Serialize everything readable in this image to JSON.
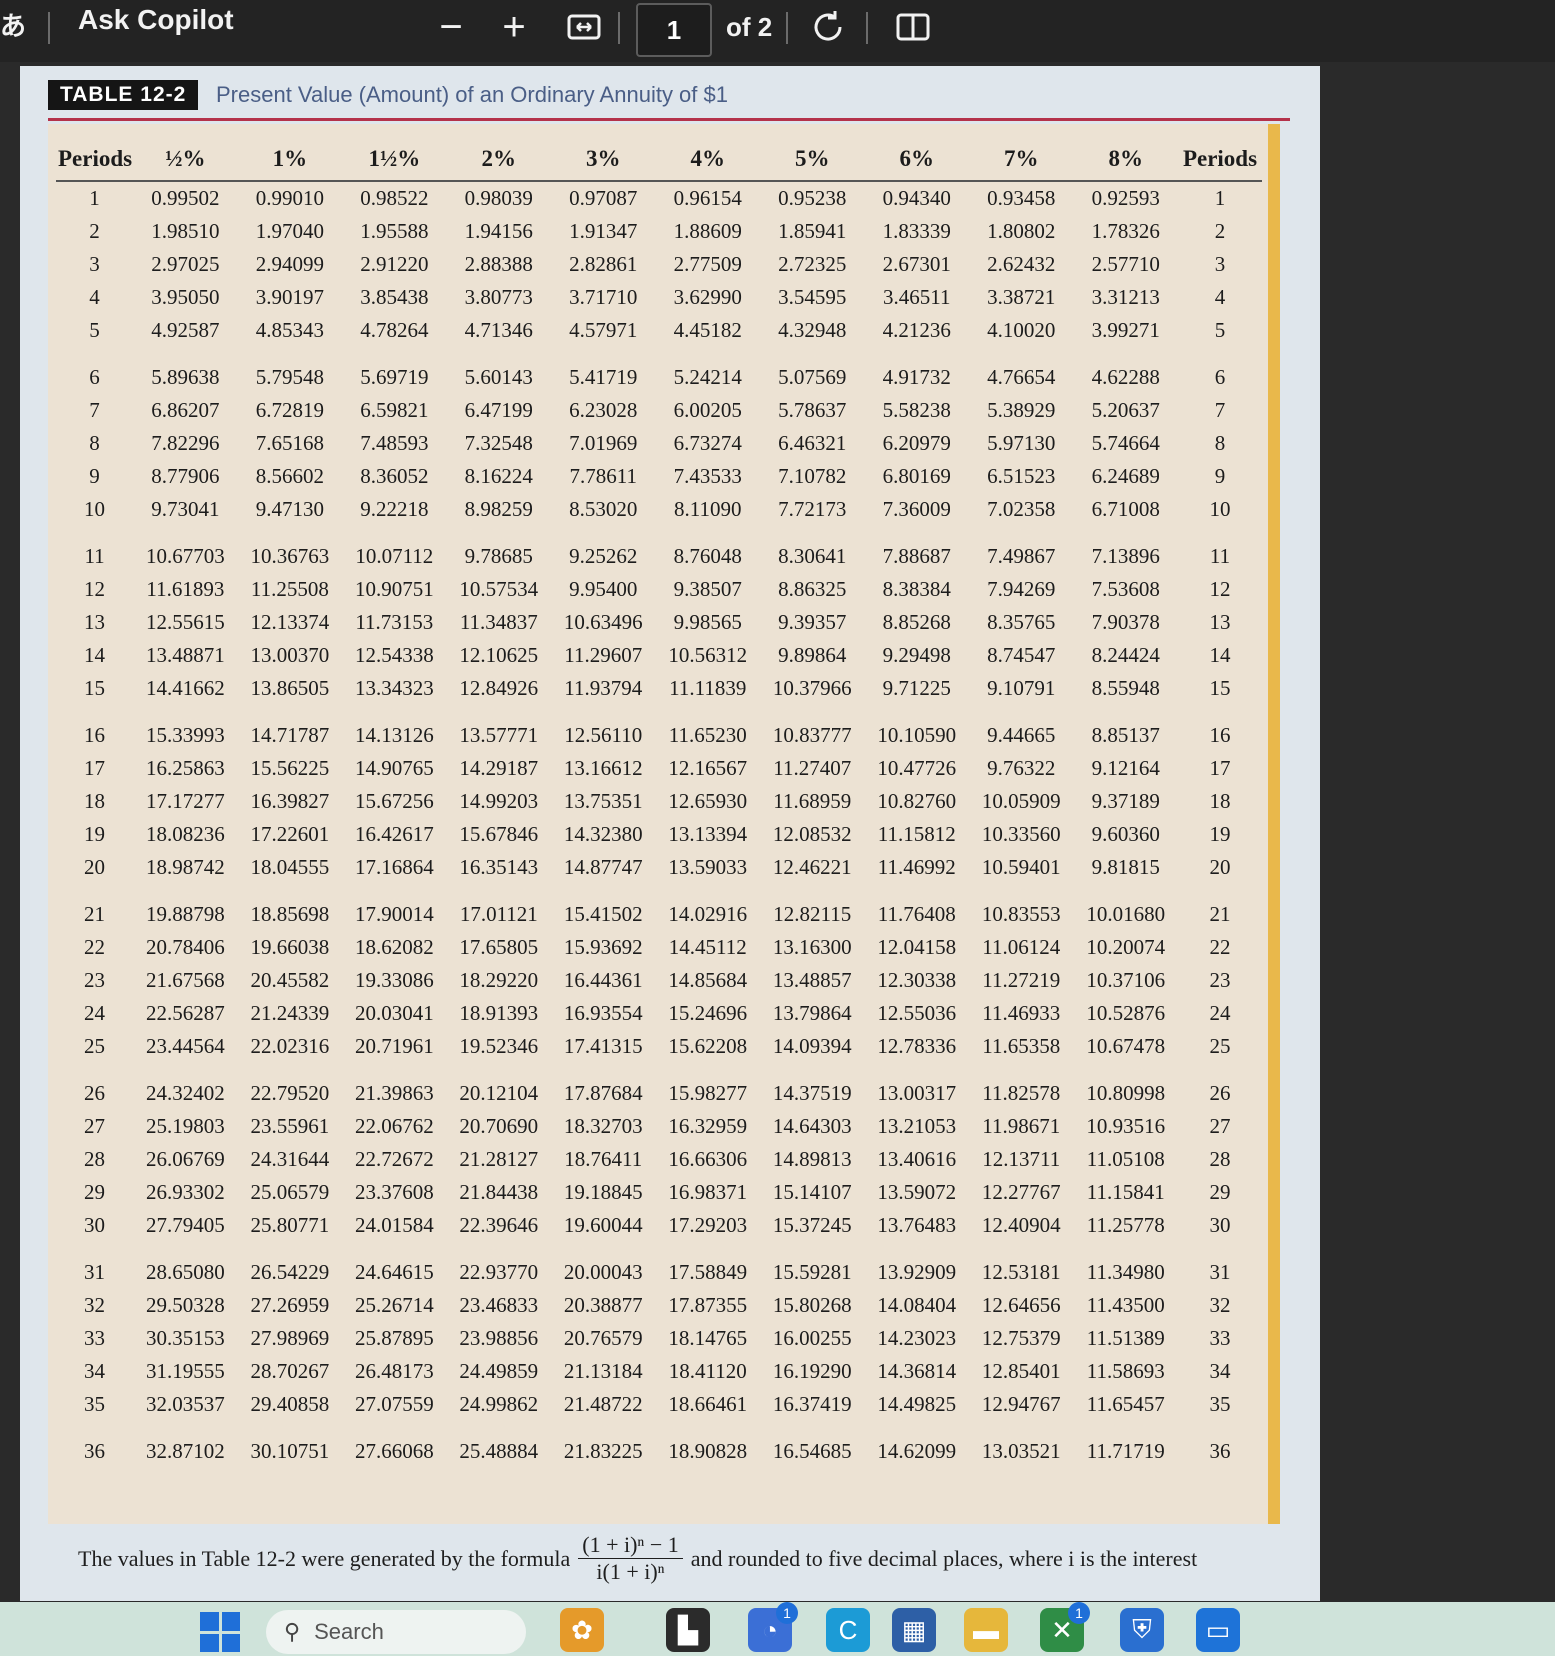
{
  "toolbar": {
    "lang_icon": "あ",
    "title": "Ask Copilot",
    "zoom_out": "−",
    "zoom_in": "+",
    "fit_icon": "fit-page-icon",
    "page_number": "1",
    "page_total": "of 2",
    "rotate_icon": "rotate-icon",
    "view_icon": "page-view-icon"
  },
  "document": {
    "table_label": "TABLE 12-2",
    "table_title": "Present Value (Amount) of an Ordinary Annuity of $1",
    "columns": [
      "Periods",
      "½%",
      "1%",
      "1½%",
      "2%",
      "3%",
      "4%",
      "5%",
      "6%",
      "7%",
      "8%",
      "Periods"
    ],
    "rows": [
      [
        "1",
        "0.99502",
        "0.99010",
        "0.98522",
        "0.98039",
        "0.97087",
        "0.96154",
        "0.95238",
        "0.94340",
        "0.93458",
        "0.92593",
        "1"
      ],
      [
        "2",
        "1.98510",
        "1.97040",
        "1.95588",
        "1.94156",
        "1.91347",
        "1.88609",
        "1.85941",
        "1.83339",
        "1.80802",
        "1.78326",
        "2"
      ],
      [
        "3",
        "2.97025",
        "2.94099",
        "2.91220",
        "2.88388",
        "2.82861",
        "2.77509",
        "2.72325",
        "2.67301",
        "2.62432",
        "2.57710",
        "3"
      ],
      [
        "4",
        "3.95050",
        "3.90197",
        "3.85438",
        "3.80773",
        "3.71710",
        "3.62990",
        "3.54595",
        "3.46511",
        "3.38721",
        "3.31213",
        "4"
      ],
      [
        "5",
        "4.92587",
        "4.85343",
        "4.78264",
        "4.71346",
        "4.57971",
        "4.45182",
        "4.32948",
        "4.21236",
        "4.10020",
        "3.99271",
        "5"
      ],
      [
        "6",
        "5.89638",
        "5.79548",
        "5.69719",
        "5.60143",
        "5.41719",
        "5.24214",
        "5.07569",
        "4.91732",
        "4.76654",
        "4.62288",
        "6"
      ],
      [
        "7",
        "6.86207",
        "6.72819",
        "6.59821",
        "6.47199",
        "6.23028",
        "6.00205",
        "5.78637",
        "5.58238",
        "5.38929",
        "5.20637",
        "7"
      ],
      [
        "8",
        "7.82296",
        "7.65168",
        "7.48593",
        "7.32548",
        "7.01969",
        "6.73274",
        "6.46321",
        "6.20979",
        "5.97130",
        "5.74664",
        "8"
      ],
      [
        "9",
        "8.77906",
        "8.56602",
        "8.36052",
        "8.16224",
        "7.78611",
        "7.43533",
        "7.10782",
        "6.80169",
        "6.51523",
        "6.24689",
        "9"
      ],
      [
        "10",
        "9.73041",
        "9.47130",
        "9.22218",
        "8.98259",
        "8.53020",
        "8.11090",
        "7.72173",
        "7.36009",
        "7.02358",
        "6.71008",
        "10"
      ],
      [
        "11",
        "10.67703",
        "10.36763",
        "10.07112",
        "9.78685",
        "9.25262",
        "8.76048",
        "8.30641",
        "7.88687",
        "7.49867",
        "7.13896",
        "11"
      ],
      [
        "12",
        "11.61893",
        "11.25508",
        "10.90751",
        "10.57534",
        "9.95400",
        "9.38507",
        "8.86325",
        "8.38384",
        "7.94269",
        "7.53608",
        "12"
      ],
      [
        "13",
        "12.55615",
        "12.13374",
        "11.73153",
        "11.34837",
        "10.63496",
        "9.98565",
        "9.39357",
        "8.85268",
        "8.35765",
        "7.90378",
        "13"
      ],
      [
        "14",
        "13.48871",
        "13.00370",
        "12.54338",
        "12.10625",
        "11.29607",
        "10.56312",
        "9.89864",
        "9.29498",
        "8.74547",
        "8.24424",
        "14"
      ],
      [
        "15",
        "14.41662",
        "13.86505",
        "13.34323",
        "12.84926",
        "11.93794",
        "11.11839",
        "10.37966",
        "9.71225",
        "9.10791",
        "8.55948",
        "15"
      ],
      [
        "16",
        "15.33993",
        "14.71787",
        "14.13126",
        "13.57771",
        "12.56110",
        "11.65230",
        "10.83777",
        "10.10590",
        "9.44665",
        "8.85137",
        "16"
      ],
      [
        "17",
        "16.25863",
        "15.56225",
        "14.90765",
        "14.29187",
        "13.16612",
        "12.16567",
        "11.27407",
        "10.47726",
        "9.76322",
        "9.12164",
        "17"
      ],
      [
        "18",
        "17.17277",
        "16.39827",
        "15.67256",
        "14.99203",
        "13.75351",
        "12.65930",
        "11.68959",
        "10.82760",
        "10.05909",
        "9.37189",
        "18"
      ],
      [
        "19",
        "18.08236",
        "17.22601",
        "16.42617",
        "15.67846",
        "14.32380",
        "13.13394",
        "12.08532",
        "11.15812",
        "10.33560",
        "9.60360",
        "19"
      ],
      [
        "20",
        "18.98742",
        "18.04555",
        "17.16864",
        "16.35143",
        "14.87747",
        "13.59033",
        "12.46221",
        "11.46992",
        "10.59401",
        "9.81815",
        "20"
      ],
      [
        "21",
        "19.88798",
        "18.85698",
        "17.90014",
        "17.01121",
        "15.41502",
        "14.02916",
        "12.82115",
        "11.76408",
        "10.83553",
        "10.01680",
        "21"
      ],
      [
        "22",
        "20.78406",
        "19.66038",
        "18.62082",
        "17.65805",
        "15.93692",
        "14.45112",
        "13.16300",
        "12.04158",
        "11.06124",
        "10.20074",
        "22"
      ],
      [
        "23",
        "21.67568",
        "20.45582",
        "19.33086",
        "18.29220",
        "16.44361",
        "14.85684",
        "13.48857",
        "12.30338",
        "11.27219",
        "10.37106",
        "23"
      ],
      [
        "24",
        "22.56287",
        "21.24339",
        "20.03041",
        "18.91393",
        "16.93554",
        "15.24696",
        "13.79864",
        "12.55036",
        "11.46933",
        "10.52876",
        "24"
      ],
      [
        "25",
        "23.44564",
        "22.02316",
        "20.71961",
        "19.52346",
        "17.41315",
        "15.62208",
        "14.09394",
        "12.78336",
        "11.65358",
        "10.67478",
        "25"
      ],
      [
        "26",
        "24.32402",
        "22.79520",
        "21.39863",
        "20.12104",
        "17.87684",
        "15.98277",
        "14.37519",
        "13.00317",
        "11.82578",
        "10.80998",
        "26"
      ],
      [
        "27",
        "25.19803",
        "23.55961",
        "22.06762",
        "20.70690",
        "18.32703",
        "16.32959",
        "14.64303",
        "13.21053",
        "11.98671",
        "10.93516",
        "27"
      ],
      [
        "28",
        "26.06769",
        "24.31644",
        "22.72672",
        "21.28127",
        "18.76411",
        "16.66306",
        "14.89813",
        "13.40616",
        "12.13711",
        "11.05108",
        "28"
      ],
      [
        "29",
        "26.93302",
        "25.06579",
        "23.37608",
        "21.84438",
        "19.18845",
        "16.98371",
        "15.14107",
        "13.59072",
        "12.27767",
        "11.15841",
        "29"
      ],
      [
        "30",
        "27.79405",
        "25.80771",
        "24.01584",
        "22.39646",
        "19.60044",
        "17.29203",
        "15.37245",
        "13.76483",
        "12.40904",
        "11.25778",
        "30"
      ],
      [
        "31",
        "28.65080",
        "26.54229",
        "24.64615",
        "22.93770",
        "20.00043",
        "17.58849",
        "15.59281",
        "13.92909",
        "12.53181",
        "11.34980",
        "31"
      ],
      [
        "32",
        "29.50328",
        "27.26959",
        "25.26714",
        "23.46833",
        "20.38877",
        "17.87355",
        "15.80268",
        "14.08404",
        "12.64656",
        "11.43500",
        "32"
      ],
      [
        "33",
        "30.35153",
        "27.98969",
        "25.87895",
        "23.98856",
        "20.76579",
        "18.14765",
        "16.00255",
        "14.23023",
        "12.75379",
        "11.51389",
        "33"
      ],
      [
        "34",
        "31.19555",
        "28.70267",
        "26.48173",
        "24.49859",
        "21.13184",
        "18.41120",
        "16.19290",
        "14.36814",
        "12.85401",
        "11.58693",
        "34"
      ],
      [
        "35",
        "32.03537",
        "29.40858",
        "27.07559",
        "24.99862",
        "21.48722",
        "18.66461",
        "16.37419",
        "14.49825",
        "12.94767",
        "11.65457",
        "35"
      ],
      [
        "36",
        "32.87102",
        "30.10751",
        "27.66068",
        "25.48884",
        "21.83225",
        "18.90828",
        "16.54685",
        "14.62099",
        "13.03521",
        "11.71719",
        "36"
      ]
    ],
    "footnote_before": "The values in Table 12-2 were generated by the formula",
    "formula_numerator": "(1 + i)ⁿ − 1",
    "formula_denominator": "i(1 + i)ⁿ",
    "footnote_after": "and rounded to five decimal places, where i is the interest"
  },
  "taskbar": {
    "search_placeholder": "Search",
    "apps": [
      {
        "name": "widgets-icon",
        "color": "#e59a2a",
        "glyph": "✿"
      },
      {
        "name": "file-explorer-icon",
        "color": "#2b2b2b",
        "glyph": "▙"
      },
      {
        "name": "chat-icon",
        "color": "#3b6fd6",
        "glyph": "◔",
        "badge": "1"
      },
      {
        "name": "edge-icon",
        "color": "#1c9bd6",
        "glyph": "C"
      },
      {
        "name": "store-icon",
        "color": "#2d5fa6",
        "glyph": "▦"
      },
      {
        "name": "folder-icon",
        "color": "#e6b73b",
        "glyph": "▬"
      },
      {
        "name": "xbox-icon",
        "color": "#2f8d46",
        "glyph": "✕",
        "badge": "1"
      },
      {
        "name": "security-icon",
        "color": "#2a6fd0",
        "glyph": "⛨"
      },
      {
        "name": "pc-icon",
        "color": "#1e73d8",
        "glyph": "▭"
      }
    ]
  }
}
